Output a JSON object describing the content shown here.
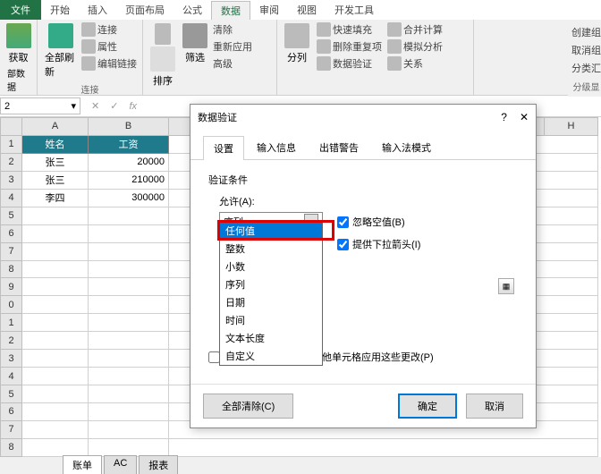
{
  "tabs": {
    "file": "文件",
    "home": "开始",
    "insert": "插入",
    "page_layout": "页面布局",
    "formulas": "公式",
    "data": "数据",
    "review": "审阅",
    "view": "视图",
    "developer": "开发工具"
  },
  "ribbon": {
    "get": "获取",
    "ext_data": "部数据",
    "refresh_all": "全部刷新",
    "connections": "连接",
    "properties": "属性",
    "edit_links": "编辑链接",
    "conn_group": "连接",
    "sort": "排序",
    "filter": "筛选",
    "clear": "清除",
    "reapply": "重新应用",
    "advanced": "高级",
    "text_to_cols": "分列",
    "flash_fill": "快速填充",
    "remove_dup": "删除重复项",
    "data_val": "数据验证",
    "consolidate": "合并计算",
    "what_if": "模拟分析",
    "relationships": "关系",
    "right1": "创建组",
    "right2": "取消组",
    "right3": "分类汇",
    "right_group": "分级显"
  },
  "cell_ref": "2",
  "columns": {
    "A": "A",
    "B": "B",
    "H": "H"
  },
  "headers": {
    "name": "姓名",
    "salary": "工资"
  },
  "rows": [
    {
      "n": "1"
    },
    {
      "n": "2",
      "name": "张三",
      "salary": "20000"
    },
    {
      "n": "3",
      "name": "张三",
      "salary": "210000"
    },
    {
      "n": "4",
      "name": "李四",
      "salary": "300000"
    }
  ],
  "dialog": {
    "title": "数据验证",
    "tabs": {
      "settings": "设置",
      "input": "输入信息",
      "error": "出错警告",
      "ime": "输入法模式"
    },
    "cond": "验证条件",
    "allow": "允许(A):",
    "selected": "序列",
    "ignore_blank": "忽略空值(B)",
    "in_cell_dropdown": "提供下拉箭头(I)",
    "options": {
      "any": "任何值",
      "whole": "整数",
      "decimal": "小数",
      "list": "序列",
      "date": "日期",
      "time": "时间",
      "text_len": "文本长度",
      "custom": "自定义"
    },
    "apply_all": "对有同样设置的所有其他单元格应用这些更改(P)",
    "clear_all": "全部清除(C)",
    "ok": "确定",
    "cancel": "取消"
  },
  "sheet_tabs": {
    "s1": "账单",
    "s2": "AC",
    "s3": "报表"
  }
}
